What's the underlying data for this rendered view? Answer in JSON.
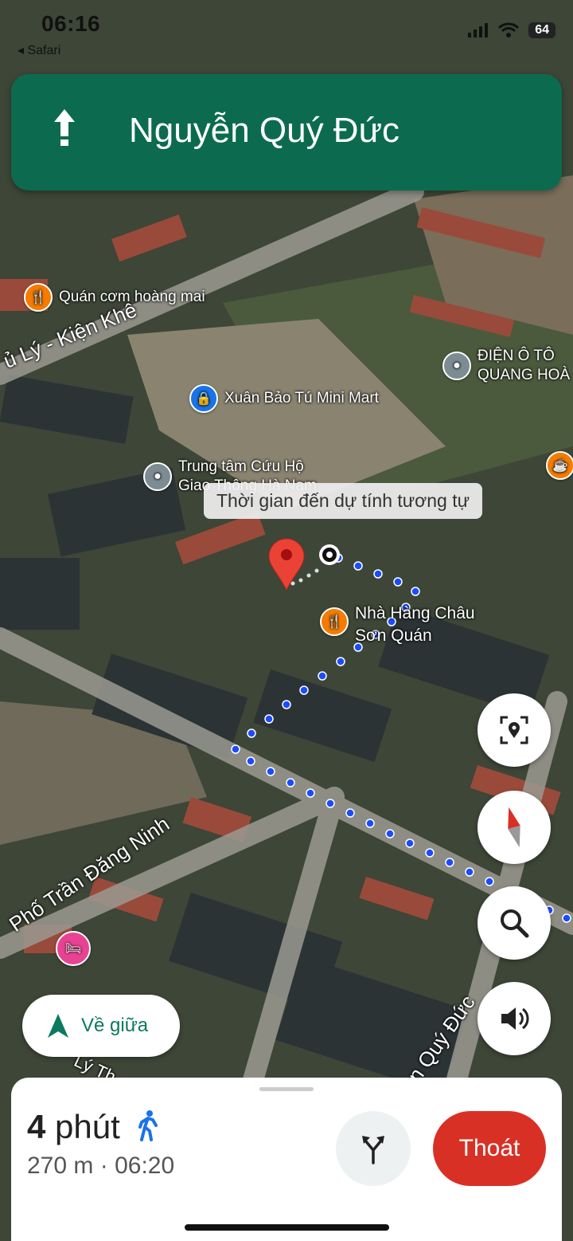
{
  "status_bar": {
    "time": "06:16",
    "back_label": "Safari",
    "battery": "64"
  },
  "navigation": {
    "street": "Nguyễn Quý Đức"
  },
  "pois": [
    {
      "label": "Quán cơm hoàng mai",
      "icon": "restaurant-icon",
      "color": "#f57c00"
    },
    {
      "label": "ĐIỆN Ô TÔ\nQUANG HOÀ",
      "icon": "place-icon",
      "color": "#7d8b93"
    },
    {
      "label": "Xuân Bảo Tú Mini Mart",
      "icon": "shopping-bag-icon",
      "color": "#1a73e8"
    },
    {
      "label": "Trung tâm Cứu Hộ\nGiao Thông Hà Nam",
      "icon": "place-icon",
      "color": "#7d8b93"
    },
    {
      "label": "Nhà Hàng Châu\nSơn Quán",
      "icon": "restaurant-icon",
      "color": "#f57c00"
    }
  ],
  "roads": {
    "road1": "ủ Lý - Kiện Khê",
    "road2": "Phố Trần Đăng Ninh",
    "road3": "n Quý Đức",
    "road4": "Lý Th"
  },
  "tooltip": "Thời gian đến dự tính tương tự",
  "controls": {
    "recenter_label": "Về giữa"
  },
  "trip": {
    "duration_value": "4",
    "duration_unit": "phút",
    "distance": "270 m",
    "arrival": "06:20",
    "separator": "·",
    "exit_label": "Thoát"
  },
  "colors": {
    "banner": "#0c6b4e",
    "route": "#1a4cff",
    "exit": "#d93025",
    "accent": "#0b7a5e"
  }
}
